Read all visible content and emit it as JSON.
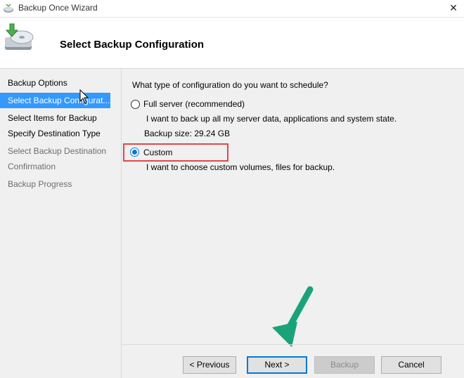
{
  "window": {
    "title": "Backup Once Wizard",
    "close_glyph": "✕"
  },
  "header": {
    "title": "Select Backup Configuration",
    "icon": "backup-disc-icon"
  },
  "sidebar": {
    "items": [
      {
        "label": "Backup Options",
        "state": "normal"
      },
      {
        "label": "Select Backup Configurat...",
        "state": "active"
      },
      {
        "label": "Select Items for Backup",
        "state": "normal"
      },
      {
        "label": "Specify Destination Type",
        "state": "normal"
      },
      {
        "label": "Select Backup Destination",
        "state": "disabled"
      },
      {
        "label": "Confirmation",
        "state": "disabled"
      },
      {
        "label": "Backup Progress",
        "state": "disabled"
      }
    ]
  },
  "main": {
    "question": "What type of configuration do you want to schedule?",
    "options": [
      {
        "label": "Full server (recommended)",
        "description": "I want to back up all my server data, applications and system state.",
        "extra": "Backup size: 29.24 GB",
        "checked": false
      },
      {
        "label": "Custom",
        "description": "I want to choose custom volumes, files for backup.",
        "checked": true
      }
    ]
  },
  "buttons": {
    "previous": "< Previous",
    "next": "Next >",
    "backup": "Backup",
    "cancel": "Cancel"
  },
  "colors": {
    "accent": "#3399ff",
    "radio_checked": "#0078d7",
    "highlight": "#e0484a",
    "arrow": "#1aa37a"
  }
}
